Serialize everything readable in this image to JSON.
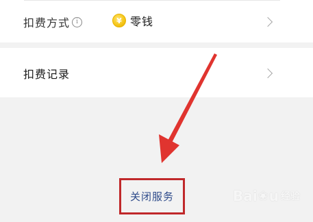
{
  "payment_method": {
    "label": "扣费方式",
    "info_icon": "info-icon",
    "coin_symbol": "¥",
    "value": "零钱"
  },
  "records": {
    "label": "扣费记录"
  },
  "close_service": {
    "label": "关闭服务"
  },
  "annotation": {
    "arrow_color": "#e0342f",
    "box_color": "#c0282a"
  },
  "watermark": {
    "brand_left": "Bai",
    "brand_right": "u",
    "sub": "经验"
  }
}
